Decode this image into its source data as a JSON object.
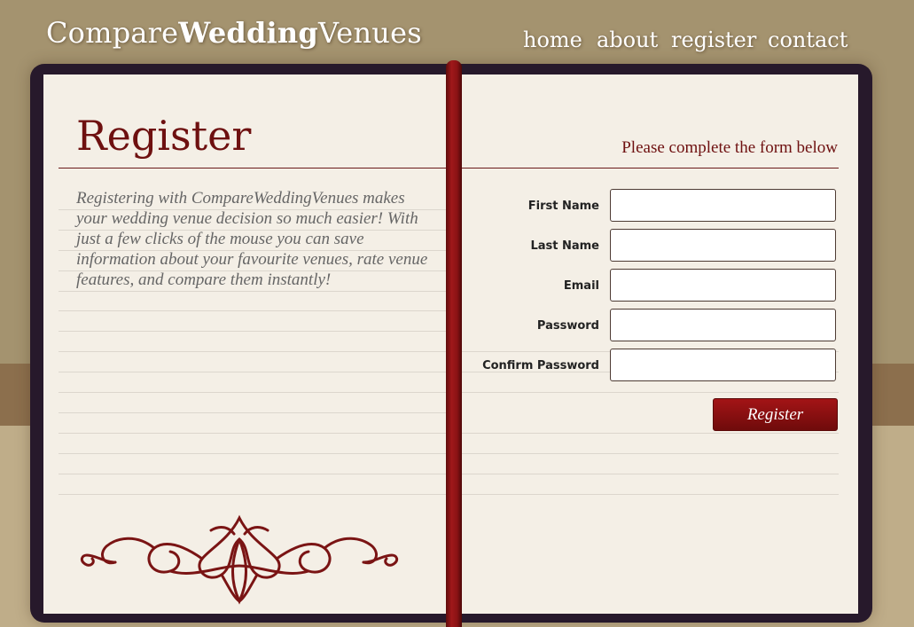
{
  "logo": {
    "part1": "Compare",
    "part2": "Wedding",
    "part3": "Venues"
  },
  "nav": {
    "home": "home",
    "about": "about",
    "register": "register",
    "contact": "contact"
  },
  "heading": {
    "title": "Register",
    "subtitle": "Please complete the form below"
  },
  "intro": "Registering with CompareWeddingVenues makes your wedding venue decision so much easier! With just a few clicks of the mouse you can save information about your favourite venues, rate venue features, and compare them instantly!",
  "form": {
    "first_name_label": "First Name",
    "last_name_label": "Last Name",
    "email_label": "Email",
    "password_label": "Password",
    "confirm_password_label": "Confirm Password",
    "first_name_value": "",
    "last_name_value": "",
    "email_value": "",
    "password_value": "",
    "confirm_password_value": "",
    "submit_label": "Register"
  },
  "colors": {
    "accent": "#6e1010",
    "background": "#a4936f",
    "book": "#27192b",
    "paper": "#f4efe6"
  },
  "icons": {
    "ornament": "flourish-ornament-icon"
  }
}
